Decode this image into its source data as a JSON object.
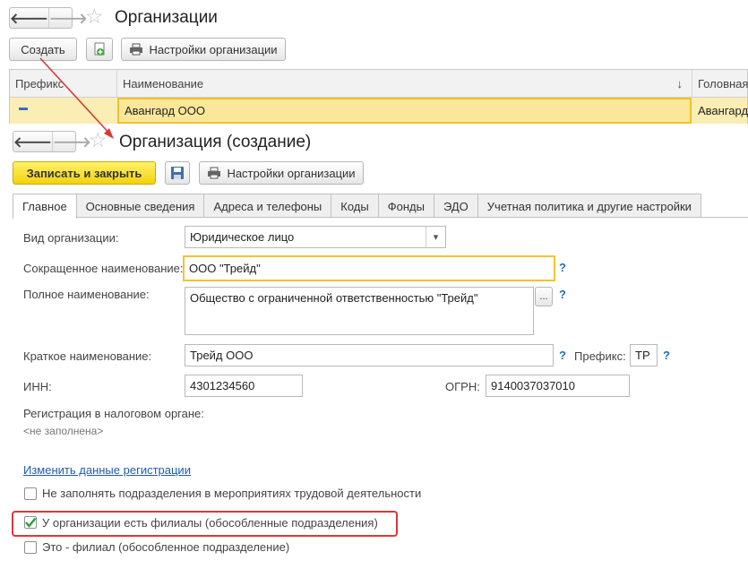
{
  "list": {
    "title": "Организации",
    "create_label": "Создать",
    "settings_label": "Настройки организации",
    "columns": [
      "Префикс",
      "Наименование",
      "↓",
      "Головная"
    ],
    "row": {
      "prefix": "▬",
      "name": "Авангард ООО",
      "head": "Авангард"
    }
  },
  "form": {
    "title": "Организация (создание)",
    "save_close_label": "Записать и закрыть",
    "settings_label": "Настройки организации",
    "tabs": [
      "Главное",
      "Основные сведения",
      "Адреса и телефоны",
      "Коды",
      "Фонды",
      "ЭДО",
      "Учетная политика и другие настройки"
    ],
    "org_type_label": "Вид организации:",
    "org_type_value": "Юридическое лицо",
    "short_name_label": "Сокращенное наименование:",
    "short_name_value": "ООО \"Трейд\"",
    "full_name_label": "Полное наименование:",
    "full_name_value": "Общество с ограниченной ответственностью \"Трейд\"",
    "brief_name_label": "Краткое наименование:",
    "brief_name_value": "Трейд ООО",
    "prefix_label": "Префикс:",
    "prefix_value": "ТР",
    "inn_label": "ИНН:",
    "inn_value": "4301234560",
    "ogrn_label": "ОГРН:",
    "ogrn_value": "9140037037010",
    "tax_reg_label": "Регистрация в налоговом органе:",
    "tax_reg_value": "<не заполнена>",
    "change_reg_link": "Изменить данные регистрации",
    "chk_no_fill": "Не заполнять подразделения в мероприятиях трудовой деятельности",
    "chk_branches": "У организации есть филиалы (обособленные подразделения)",
    "chk_is_branch": "Это - филиал (обособленное подразделение)",
    "chk_no_fill_checked": false,
    "chk_branches_checked": true,
    "chk_is_branch_checked": false,
    "q": "?",
    "ellipsis": "...",
    "dropdown_arrow": "▾"
  },
  "colors": {
    "accent_yellow": "#f3d20d",
    "highlight_red": "#d9393b",
    "link": "#1f5cb0"
  }
}
